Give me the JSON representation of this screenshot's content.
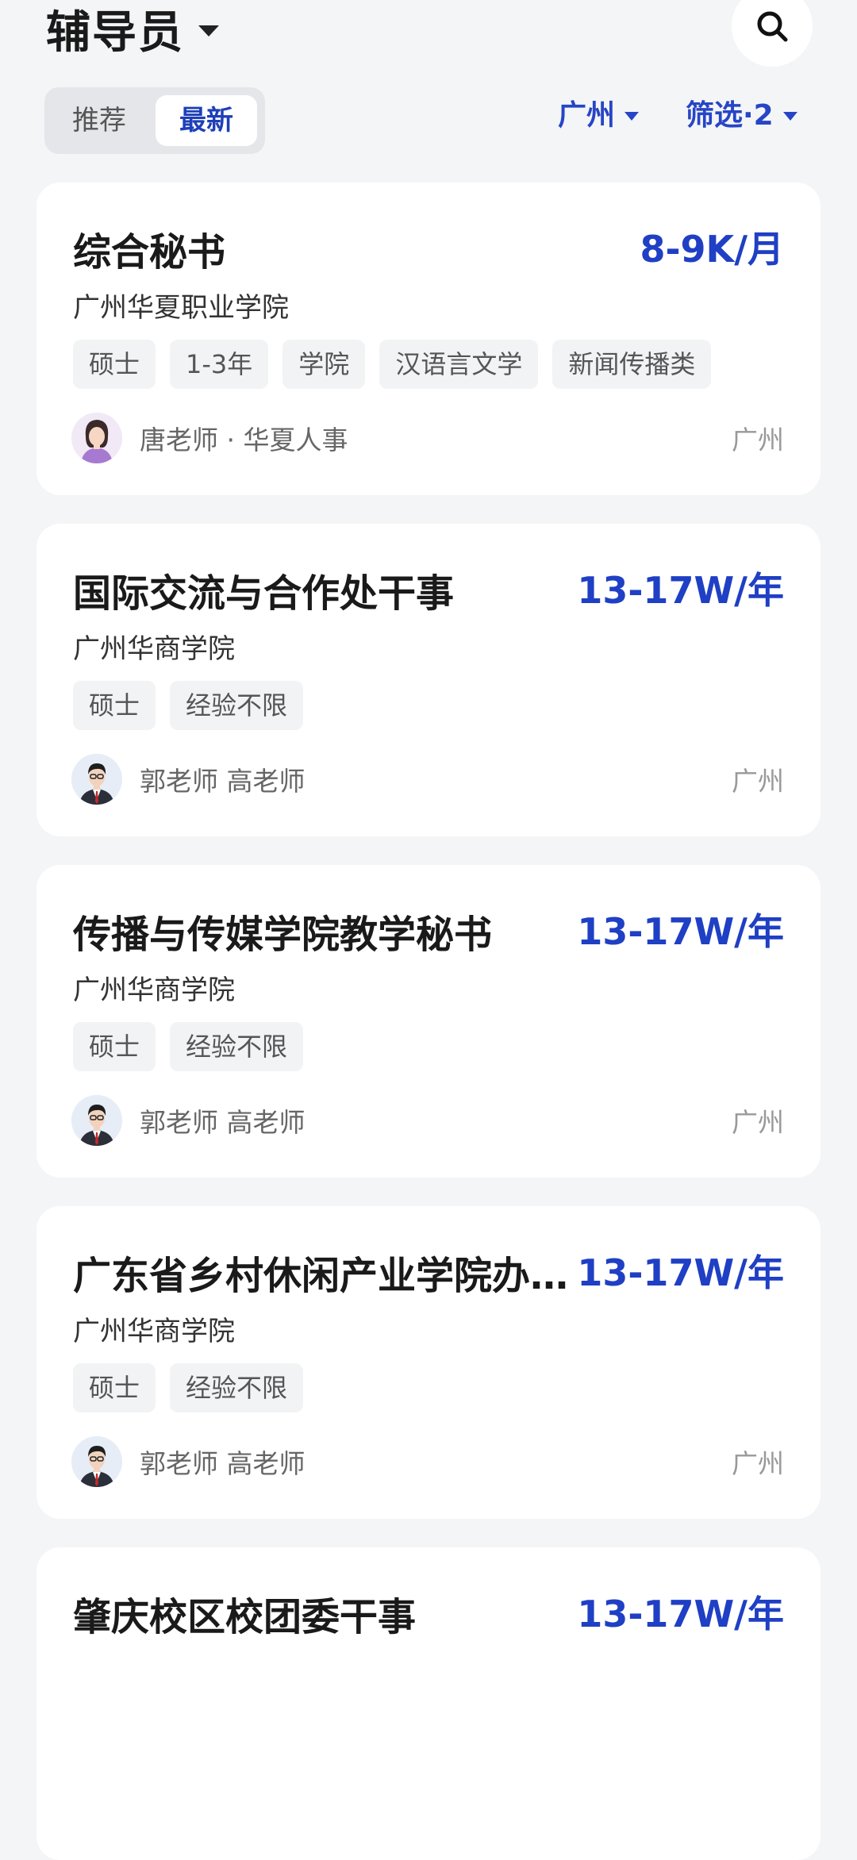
{
  "header": {
    "title": "辅导员"
  },
  "toggle": {
    "recommend": "推荐",
    "latest": "最新",
    "selected": "最新"
  },
  "filters": {
    "city": "广州",
    "more": "筛选·2"
  },
  "jobs": [
    {
      "title": "综合秘书",
      "salary": "8-9K/月",
      "company": "广州华夏职业学院",
      "tags": [
        "硕士",
        "1-3年",
        "学院",
        "汉语言文学",
        "新闻传播类"
      ],
      "recruiter": "唐老师 · 华夏人事",
      "location": "广州",
      "avatar": "female-avatar"
    },
    {
      "title": "国际交流与合作处干事",
      "salary": "13-17W/年",
      "company": "广州华商学院",
      "tags": [
        "硕士",
        "经验不限"
      ],
      "recruiter": "郭老师 高老师",
      "location": "广州",
      "avatar": "male-avatar"
    },
    {
      "title": "传播与传媒学院教学秘书",
      "salary": "13-17W/年",
      "company": "广州华商学院",
      "tags": [
        "硕士",
        "经验不限"
      ],
      "recruiter": "郭老师 高老师",
      "location": "广州",
      "avatar": "male-avatar"
    },
    {
      "title": "广东省乡村休闲产业学院办…",
      "salary": "13-17W/年",
      "company": "广州华商学院",
      "tags": [
        "硕士",
        "经验不限"
      ],
      "recruiter": "郭老师 高老师",
      "location": "广州",
      "avatar": "male-avatar"
    },
    {
      "title": "肇庆校区校团委干事",
      "salary": "13-17W/年",
      "company": "",
      "tags": [],
      "recruiter": "",
      "location": "",
      "avatar": ""
    }
  ],
  "colors": {
    "accent": "#1f3fc4",
    "background": "#f4f5f7",
    "card": "#ffffff"
  }
}
